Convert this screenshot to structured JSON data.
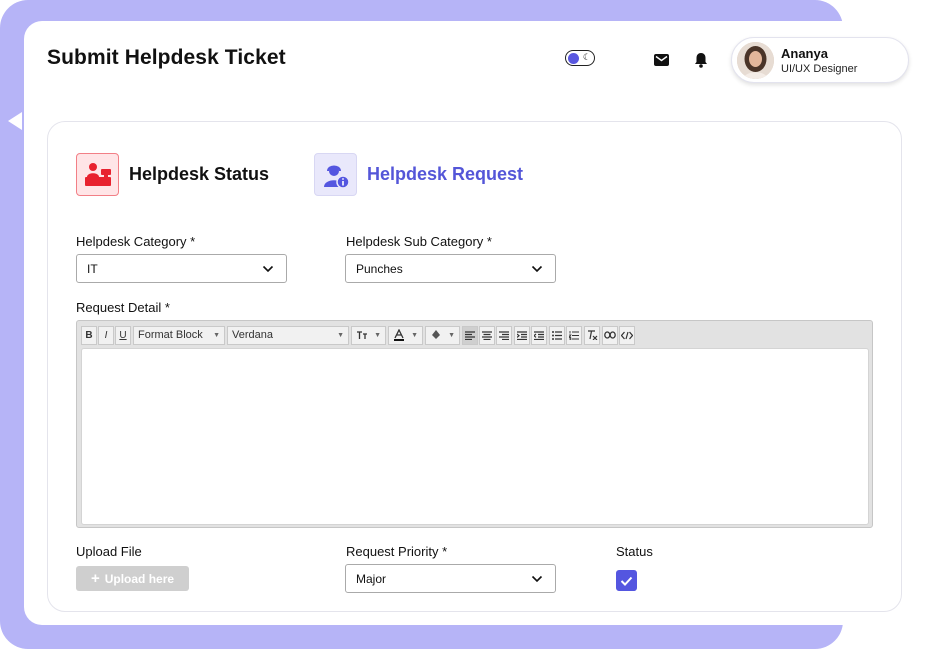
{
  "header": {
    "title": "Submit Helpdesk Ticket"
  },
  "user": {
    "name": "Ananya",
    "role": "UI/UX Designer"
  },
  "tabs": [
    {
      "label": "Helpdesk Status",
      "icon": "helpdesk-desk-icon",
      "active": false
    },
    {
      "label": "Helpdesk Request",
      "icon": "support-agent-icon",
      "active": true
    }
  ],
  "form": {
    "category": {
      "label": "Helpdesk Category *",
      "value": "IT"
    },
    "sub_category": {
      "label": "Helpdesk Sub Category *",
      "value": "Punches"
    },
    "request_detail": {
      "label": "Request Detail *",
      "toolbar": {
        "block_format": "Format Block",
        "font_name": "Verdana",
        "bold": "B",
        "italic": "I",
        "underline": "U"
      },
      "content": ""
    },
    "upload": {
      "label": "Upload File",
      "button": "Upload here"
    },
    "priority": {
      "label": "Request Priority *",
      "value": "Major"
    },
    "status": {
      "label": "Status",
      "checked": true
    }
  },
  "colors": {
    "frame": "#b6b4f7",
    "accent": "#5456e0",
    "status_tile_border": "#f27f86",
    "status_tile_bg": "#ffe5e7"
  }
}
